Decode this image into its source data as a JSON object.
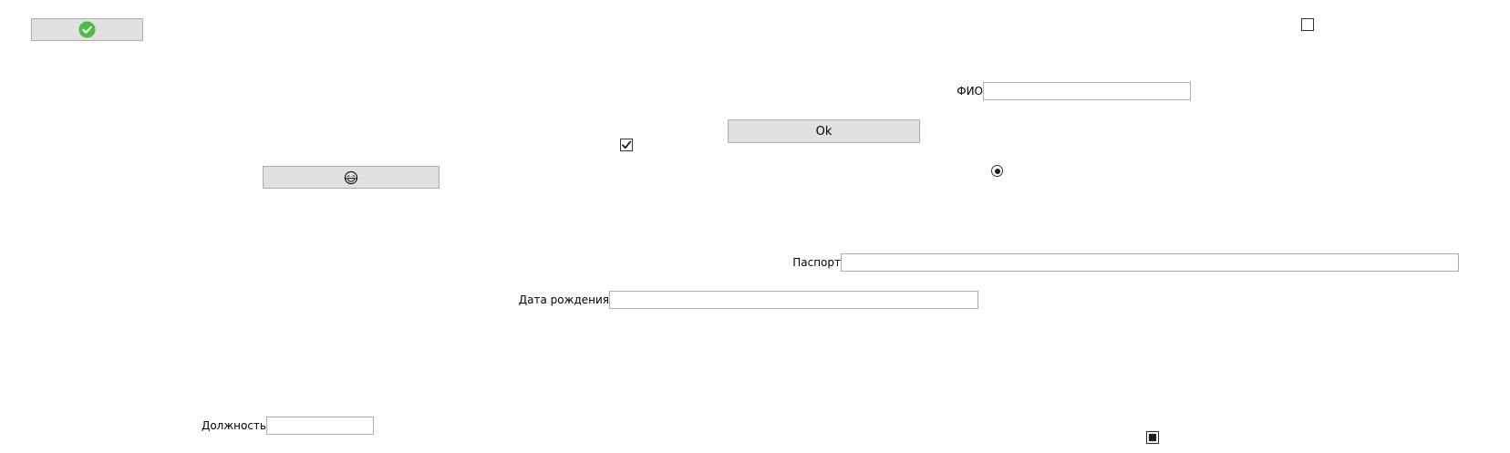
{
  "buttons": {
    "confirm_icon": "check-circle-icon",
    "confirm_icon_color": "#4cbb47",
    "ok_label": "Ok",
    "emoji_icon": "laughing-face-icon",
    "emoji_glyph": "😂"
  },
  "fields": {
    "fio": {
      "label": "ФИО",
      "value": ""
    },
    "passport": {
      "label": "Паспорт",
      "value": ""
    },
    "birth_date": {
      "label": "Дата рождения",
      "value": ""
    },
    "position": {
      "label": "Должность",
      "value": ""
    }
  },
  "checkboxes": {
    "top_right": {
      "state": "unchecked"
    },
    "middle": {
      "state": "checked"
    },
    "bottom_right": {
      "state": "indeterminate"
    }
  },
  "radio": {
    "state": "selected"
  },
  "colors": {
    "button_bg": "#e1e1e1",
    "button_border": "#adadad",
    "input_border": "#abadb3"
  }
}
